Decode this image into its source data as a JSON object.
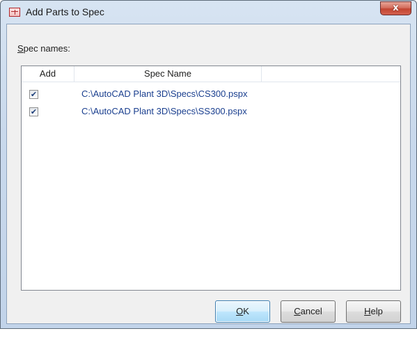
{
  "window": {
    "title": "Add Parts to Spec",
    "close_glyph": "x"
  },
  "labels": {
    "spec_names_mnemonic": "S",
    "spec_names_rest": "pec names:"
  },
  "list": {
    "columns": [
      "Add",
      "Spec Name",
      ""
    ],
    "rows": [
      {
        "checked": true,
        "spec_name": "C:\\AutoCAD Plant 3D\\Specs\\CS300.pspx"
      },
      {
        "checked": true,
        "spec_name": "C:\\AutoCAD Plant 3D\\Specs\\SS300.pspx"
      }
    ]
  },
  "buttons": {
    "ok": {
      "mnemonic": "O",
      "rest": "K"
    },
    "cancel": {
      "mnemonic": "C",
      "rest": "ancel"
    },
    "help": {
      "mnemonic": "H",
      "rest": "elp"
    }
  },
  "icons": {
    "app": "spec-table-icon",
    "checkmark": "✔"
  }
}
